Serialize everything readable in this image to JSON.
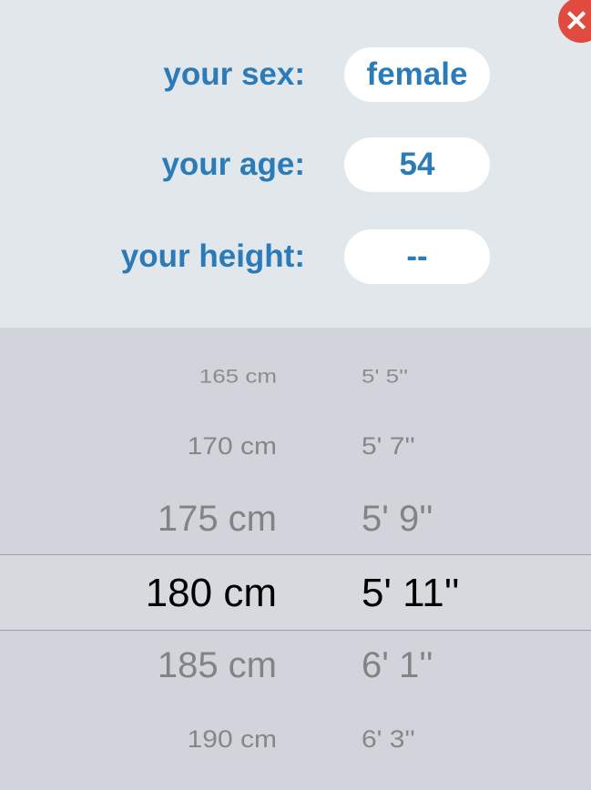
{
  "form": {
    "sex": {
      "label": "your sex:",
      "value": "female"
    },
    "age": {
      "label": "your age:",
      "value": "54"
    },
    "height": {
      "label": "your height:",
      "value": "--"
    }
  },
  "close_icon": "close-icon",
  "colors": {
    "accent": "#2b7bb9",
    "close": "#e04a3f",
    "selected_text": "#000000",
    "dim_text": "#8a8a8a"
  },
  "picker": {
    "options": [
      {
        "cm": "165 cm",
        "ft": "5' 5''"
      },
      {
        "cm": "170 cm",
        "ft": "5' 7''"
      },
      {
        "cm": "175 cm",
        "ft": "5' 9''"
      },
      {
        "cm": "180 cm",
        "ft": "5' 11''"
      },
      {
        "cm": "185 cm",
        "ft": "6' 1''"
      },
      {
        "cm": "190 cm",
        "ft": "6' 3''"
      }
    ],
    "selected_index": 3
  }
}
